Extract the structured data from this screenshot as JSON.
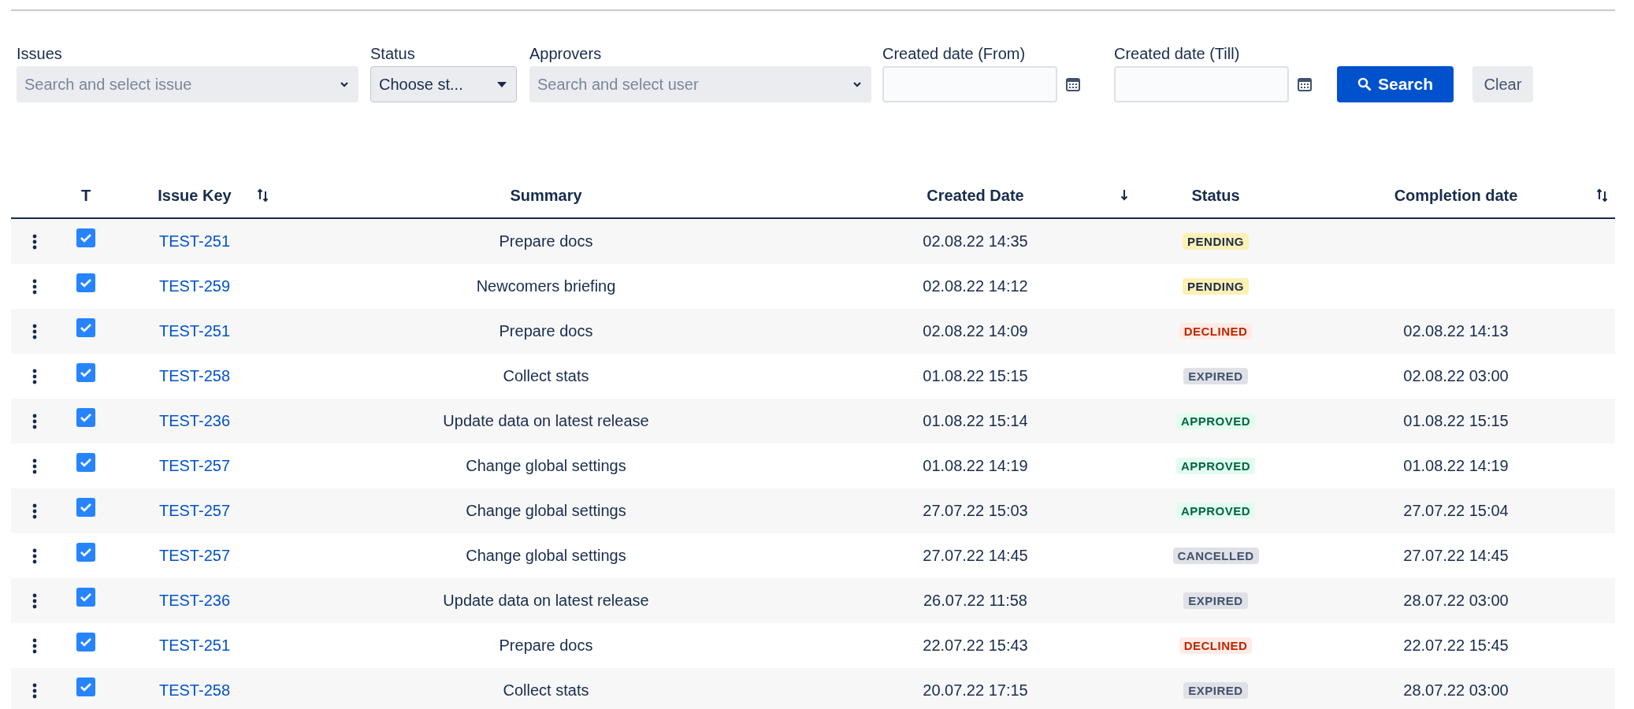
{
  "filters": {
    "issues": {
      "label": "Issues",
      "placeholder": "Search and select issue"
    },
    "status": {
      "label": "Status",
      "value": "Choose st..."
    },
    "approvers": {
      "label": "Approvers",
      "placeholder": "Search and select user"
    },
    "created_from": {
      "label": "Created date (From)"
    },
    "created_till": {
      "label": "Created date (Till)"
    },
    "search_button": "Search",
    "clear_button": "Clear"
  },
  "table": {
    "columns": [
      {
        "label": "T",
        "kind": "plain"
      },
      {
        "label": "Issue Key",
        "kind": "sortable"
      },
      {
        "label": "Summary",
        "kind": "plain"
      },
      {
        "label": "Created Date",
        "kind": "sorted_desc"
      },
      {
        "label": "Status",
        "kind": "plain"
      },
      {
        "label": "Completion date",
        "kind": "sortable"
      }
    ],
    "rows": [
      {
        "checked": true,
        "key": "TEST-251",
        "summary": "Prepare docs",
        "created": "02.08.22 14:35",
        "status": {
          "label": "PENDING",
          "kind": "pending"
        }
      },
      {
        "checked": true,
        "key": "TEST-259",
        "summary": "Newcomers briefing",
        "created": "02.08.22 14:12",
        "status": {
          "label": "PENDING",
          "kind": "pending"
        }
      },
      {
        "checked": true,
        "key": "TEST-251",
        "summary": "Prepare docs",
        "created": "02.08.22 14:09",
        "status": {
          "label": "DECLINED",
          "kind": "declined"
        },
        "completed": "02.08.22 14:13"
      },
      {
        "checked": true,
        "key": "TEST-258",
        "summary": "Collect stats",
        "created": "01.08.22 15:15",
        "status": {
          "label": "EXPIRED",
          "kind": "expired"
        },
        "completed": "02.08.22 03:00"
      },
      {
        "checked": true,
        "key": "TEST-236",
        "summary": "Update data on latest release",
        "created": "01.08.22 15:14",
        "status": {
          "label": "APPROVED",
          "kind": "approved"
        },
        "completed": "01.08.22 15:15"
      },
      {
        "checked": true,
        "key": "TEST-257",
        "summary": "Change global settings",
        "created": "01.08.22 14:19",
        "status": {
          "label": "APPROVED",
          "kind": "approved"
        },
        "completed": "01.08.22 14:19"
      },
      {
        "checked": true,
        "key": "TEST-257",
        "summary": "Change global settings",
        "created": "27.07.22 15:03",
        "status": {
          "label": "APPROVED",
          "kind": "approved"
        },
        "completed": "27.07.22 15:04"
      },
      {
        "checked": true,
        "key": "TEST-257",
        "summary": "Change global settings",
        "created": "27.07.22 14:45",
        "status": {
          "label": "CANCELLED",
          "kind": "cancelled"
        },
        "completed": "27.07.22 14:45"
      },
      {
        "checked": true,
        "key": "TEST-236",
        "summary": "Update data on latest release",
        "created": "26.07.22 11:58",
        "status": {
          "label": "EXPIRED",
          "kind": "expired"
        },
        "completed": "28.07.22 03:00"
      },
      {
        "checked": true,
        "key": "TEST-251",
        "summary": "Prepare docs",
        "created": "22.07.22 15:43",
        "status": {
          "label": "DECLINED",
          "kind": "declined"
        },
        "completed": "22.07.22 15:45"
      },
      {
        "checked": true,
        "key": "TEST-258",
        "summary": "Collect stats",
        "created": "20.07.22 17:15",
        "status": {
          "label": "EXPIRED",
          "kind": "expired"
        },
        "completed": "28.07.22 03:00"
      }
    ]
  }
}
